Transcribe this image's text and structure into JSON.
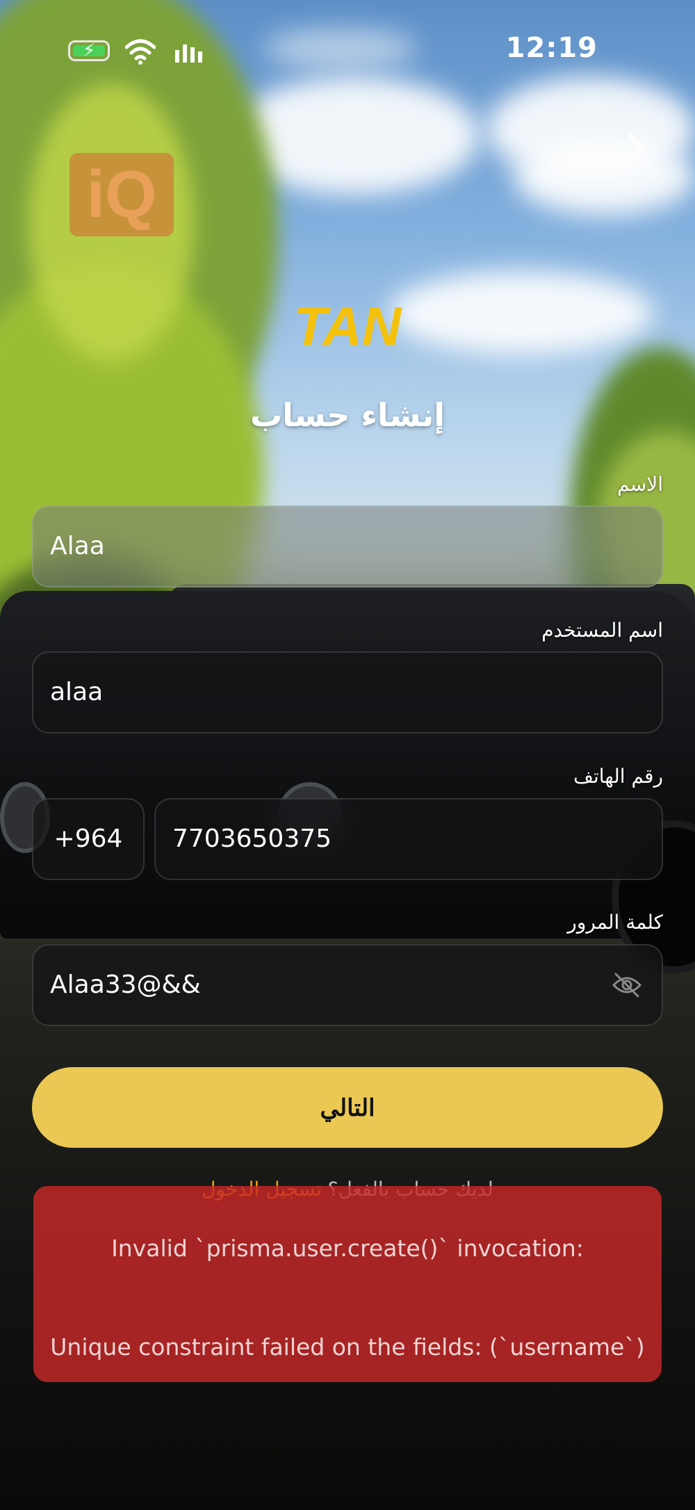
{
  "status_bar": {
    "time": "12:19",
    "battery_charging": true
  },
  "header": {
    "brand_logo_text": "TAN",
    "watermark_text": "iQ"
  },
  "page_title": "إنشاء حساب",
  "form": {
    "name": {
      "label": "الاسم",
      "value": "Alaa"
    },
    "username": {
      "label": "اسم المستخدم",
      "value": "alaa"
    },
    "phone": {
      "label": "رقم الهاتف",
      "country_code": "+964",
      "value": "7703650375"
    },
    "password": {
      "label": "كلمة المرور",
      "value": "Alaa33@&&"
    }
  },
  "next_button": {
    "label": "التالي"
  },
  "signin": {
    "prompt": "لديك حساب بالفعل؟",
    "link": "تسجيل الدخول"
  },
  "error_toast": {
    "line1": "Invalid `prisma.user.create()` invocation:",
    "line2": "Unique constraint failed on the fields: (`username`)"
  },
  "colors": {
    "accent": "#ebc853",
    "logo": "#f4c20d",
    "error": "#c82828",
    "link": "#f0a300"
  }
}
